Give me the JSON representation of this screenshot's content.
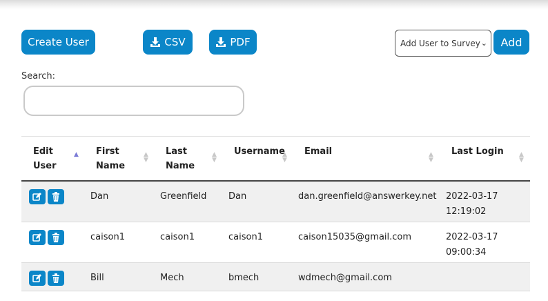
{
  "toolbar": {
    "create_user_label": "Create User",
    "csv_label": "CSV",
    "pdf_label": "PDF",
    "survey_select_value": "Add User to Survey",
    "add_label": "Add"
  },
  "search": {
    "label": "Search:",
    "value": "",
    "placeholder": ""
  },
  "table": {
    "headers": {
      "edit_user": [
        "Edit",
        "User"
      ],
      "first_name": [
        "First",
        "Name"
      ],
      "last_name": [
        "Last",
        "Name"
      ],
      "username": "Username",
      "email": "Email",
      "last_login": "Last Login"
    },
    "rows": [
      {
        "first_name": "Dan",
        "last_name": "Greenfield",
        "username": "Dan",
        "email": "dan.greenfield@answerkey.net",
        "last_login_date": "2022-03-17",
        "last_login_time": "12:19:02"
      },
      {
        "first_name": "caison1",
        "last_name": "caison1",
        "username": "caison1",
        "email": "caison15035@gmail.com",
        "last_login_date": "2022-03-17",
        "last_login_time": "09:00:34"
      },
      {
        "first_name": "Bill",
        "last_name": "Mech",
        "username": "bmech",
        "email": "wdmech@gmail.com",
        "last_login_date": "",
        "last_login_time": ""
      }
    ]
  },
  "icons": {
    "edit": "edit-icon",
    "delete": "trash-icon",
    "download": "download-icon"
  },
  "colors": {
    "accent": "#0b86c8",
    "sort_active": "#7b7bd6",
    "row_stripe": "#f0f0f0"
  }
}
